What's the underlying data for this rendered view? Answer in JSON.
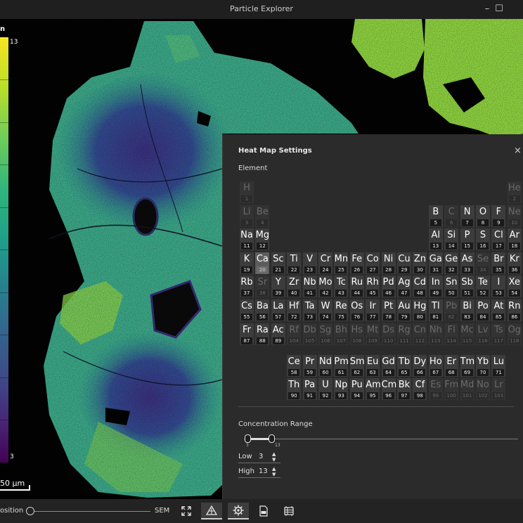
{
  "window": {
    "title": "Particle Explorer",
    "minimize": "–",
    "maximize": "☐"
  },
  "scale": {
    "top_label": "n",
    "max": "13",
    "min": "3",
    "scalebar": "50 µm",
    "colors": [
      "#f8e621",
      "#6ccd5a",
      "#1f9e89",
      "#31688e",
      "#440154"
    ]
  },
  "panel": {
    "title": "Heat Map Settings",
    "close": "×",
    "element_label": "Element",
    "selected_element": "Ca",
    "elements": [
      {
        "s": "H",
        "n": "1",
        "r": 1,
        "c": 1,
        "d": true
      },
      {
        "s": "He",
        "n": "2",
        "r": 1,
        "c": 18,
        "d": true
      },
      {
        "s": "Li",
        "n": "3",
        "r": 2,
        "c": 1,
        "d": true
      },
      {
        "s": "Be",
        "n": "4",
        "r": 2,
        "c": 2,
        "d": true
      },
      {
        "s": "B",
        "n": "5",
        "r": 2,
        "c": 13,
        "d": false
      },
      {
        "s": "C",
        "n": "6",
        "r": 2,
        "c": 14,
        "d": true
      },
      {
        "s": "N",
        "n": "7",
        "r": 2,
        "c": 15,
        "d": false
      },
      {
        "s": "O",
        "n": "8",
        "r": 2,
        "c": 16,
        "d": false
      },
      {
        "s": "F",
        "n": "9",
        "r": 2,
        "c": 17,
        "d": false
      },
      {
        "s": "Ne",
        "n": "10",
        "r": 2,
        "c": 18,
        "d": true
      },
      {
        "s": "Na",
        "n": "11",
        "r": 3,
        "c": 1,
        "d": false
      },
      {
        "s": "Mg",
        "n": "12",
        "r": 3,
        "c": 2,
        "d": false
      },
      {
        "s": "Al",
        "n": "13",
        "r": 3,
        "c": 13,
        "d": false
      },
      {
        "s": "Si",
        "n": "14",
        "r": 3,
        "c": 14,
        "d": false
      },
      {
        "s": "P",
        "n": "15",
        "r": 3,
        "c": 15,
        "d": false
      },
      {
        "s": "S",
        "n": "16",
        "r": 3,
        "c": 16,
        "d": false
      },
      {
        "s": "Cl",
        "n": "17",
        "r": 3,
        "c": 17,
        "d": false
      },
      {
        "s": "Ar",
        "n": "18",
        "r": 3,
        "c": 18,
        "d": false
      },
      {
        "s": "K",
        "n": "19",
        "r": 4,
        "c": 1,
        "d": false
      },
      {
        "s": "Ca",
        "n": "20",
        "r": 4,
        "c": 2,
        "d": false
      },
      {
        "s": "Sc",
        "n": "21",
        "r": 4,
        "c": 3,
        "d": false
      },
      {
        "s": "Ti",
        "n": "22",
        "r": 4,
        "c": 4,
        "d": false
      },
      {
        "s": "V",
        "n": "23",
        "r": 4,
        "c": 5,
        "d": false
      },
      {
        "s": "Cr",
        "n": "24",
        "r": 4,
        "c": 6,
        "d": false
      },
      {
        "s": "Mn",
        "n": "25",
        "r": 4,
        "c": 7,
        "d": false
      },
      {
        "s": "Fe",
        "n": "26",
        "r": 4,
        "c": 8,
        "d": false
      },
      {
        "s": "Co",
        "n": "27",
        "r": 4,
        "c": 9,
        "d": false
      },
      {
        "s": "Ni",
        "n": "28",
        "r": 4,
        "c": 10,
        "d": false
      },
      {
        "s": "Cu",
        "n": "29",
        "r": 4,
        "c": 11,
        "d": false
      },
      {
        "s": "Zn",
        "n": "30",
        "r": 4,
        "c": 12,
        "d": false
      },
      {
        "s": "Ga",
        "n": "31",
        "r": 4,
        "c": 13,
        "d": false
      },
      {
        "s": "Ge",
        "n": "32",
        "r": 4,
        "c": 14,
        "d": false
      },
      {
        "s": "As",
        "n": "33",
        "r": 4,
        "c": 15,
        "d": false
      },
      {
        "s": "Se",
        "n": "34",
        "r": 4,
        "c": 16,
        "d": true
      },
      {
        "s": "Br",
        "n": "35",
        "r": 4,
        "c": 17,
        "d": false
      },
      {
        "s": "Kr",
        "n": "36",
        "r": 4,
        "c": 18,
        "d": false
      },
      {
        "s": "Rb",
        "n": "37",
        "r": 5,
        "c": 1,
        "d": false
      },
      {
        "s": "Sr",
        "n": "38",
        "r": 5,
        "c": 2,
        "d": true
      },
      {
        "s": "Y",
        "n": "39",
        "r": 5,
        "c": 3,
        "d": false
      },
      {
        "s": "Zr",
        "n": "40",
        "r": 5,
        "c": 4,
        "d": false
      },
      {
        "s": "Nb",
        "n": "41",
        "r": 5,
        "c": 5,
        "d": false
      },
      {
        "s": "Mo",
        "n": "42",
        "r": 5,
        "c": 6,
        "d": false
      },
      {
        "s": "Tc",
        "n": "43",
        "r": 5,
        "c": 7,
        "d": false
      },
      {
        "s": "Ru",
        "n": "44",
        "r": 5,
        "c": 8,
        "d": false
      },
      {
        "s": "Rh",
        "n": "45",
        "r": 5,
        "c": 9,
        "d": false
      },
      {
        "s": "Pd",
        "n": "46",
        "r": 5,
        "c": 10,
        "d": false
      },
      {
        "s": "Ag",
        "n": "47",
        "r": 5,
        "c": 11,
        "d": false
      },
      {
        "s": "Cd",
        "n": "48",
        "r": 5,
        "c": 12,
        "d": false
      },
      {
        "s": "In",
        "n": "49",
        "r": 5,
        "c": 13,
        "d": false
      },
      {
        "s": "Sn",
        "n": "50",
        "r": 5,
        "c": 14,
        "d": false
      },
      {
        "s": "Sb",
        "n": "51",
        "r": 5,
        "c": 15,
        "d": false
      },
      {
        "s": "Te",
        "n": "52",
        "r": 5,
        "c": 16,
        "d": false
      },
      {
        "s": "I",
        "n": "53",
        "r": 5,
        "c": 17,
        "d": false
      },
      {
        "s": "Xe",
        "n": "54",
        "r": 5,
        "c": 18,
        "d": false
      },
      {
        "s": "Cs",
        "n": "55",
        "r": 6,
        "c": 1,
        "d": false
      },
      {
        "s": "Ba",
        "n": "56",
        "r": 6,
        "c": 2,
        "d": false
      },
      {
        "s": "La",
        "n": "57",
        "r": 6,
        "c": 3,
        "d": false
      },
      {
        "s": "Hf",
        "n": "72",
        "r": 6,
        "c": 4,
        "d": false
      },
      {
        "s": "Ta",
        "n": "73",
        "r": 6,
        "c": 5,
        "d": false
      },
      {
        "s": "W",
        "n": "74",
        "r": 6,
        "c": 6,
        "d": false
      },
      {
        "s": "Re",
        "n": "75",
        "r": 6,
        "c": 7,
        "d": false
      },
      {
        "s": "Os",
        "n": "76",
        "r": 6,
        "c": 8,
        "d": false
      },
      {
        "s": "Ir",
        "n": "77",
        "r": 6,
        "c": 9,
        "d": false
      },
      {
        "s": "Pt",
        "n": "78",
        "r": 6,
        "c": 10,
        "d": false
      },
      {
        "s": "Au",
        "n": "79",
        "r": 6,
        "c": 11,
        "d": false
      },
      {
        "s": "Hg",
        "n": "80",
        "r": 6,
        "c": 12,
        "d": false
      },
      {
        "s": "Tl",
        "n": "81",
        "r": 6,
        "c": 13,
        "d": false
      },
      {
        "s": "Pb",
        "n": "82",
        "r": 6,
        "c": 14,
        "d": true
      },
      {
        "s": "Bi",
        "n": "83",
        "r": 6,
        "c": 15,
        "d": false
      },
      {
        "s": "Po",
        "n": "84",
        "r": 6,
        "c": 16,
        "d": false
      },
      {
        "s": "At",
        "n": "85",
        "r": 6,
        "c": 17,
        "d": false
      },
      {
        "s": "Rn",
        "n": "86",
        "r": 6,
        "c": 18,
        "d": false
      },
      {
        "s": "Fr",
        "n": "87",
        "r": 7,
        "c": 1,
        "d": false
      },
      {
        "s": "Ra",
        "n": "88",
        "r": 7,
        "c": 2,
        "d": false
      },
      {
        "s": "Ac",
        "n": "89",
        "r": 7,
        "c": 3,
        "d": false
      },
      {
        "s": "Rf",
        "n": "104",
        "r": 7,
        "c": 4,
        "d": true
      },
      {
        "s": "Db",
        "n": "105",
        "r": 7,
        "c": 5,
        "d": true
      },
      {
        "s": "Sg",
        "n": "106",
        "r": 7,
        "c": 6,
        "d": true
      },
      {
        "s": "Bh",
        "n": "107",
        "r": 7,
        "c": 7,
        "d": true
      },
      {
        "s": "Hs",
        "n": "108",
        "r": 7,
        "c": 8,
        "d": true
      },
      {
        "s": "Mt",
        "n": "109",
        "r": 7,
        "c": 9,
        "d": true
      },
      {
        "s": "Ds",
        "n": "110",
        "r": 7,
        "c": 10,
        "d": true
      },
      {
        "s": "Rg",
        "n": "111",
        "r": 7,
        "c": 11,
        "d": true
      },
      {
        "s": "Cn",
        "n": "112",
        "r": 7,
        "c": 12,
        "d": true
      },
      {
        "s": "Nh",
        "n": "113",
        "r": 7,
        "c": 13,
        "d": true
      },
      {
        "s": "Fl",
        "n": "114",
        "r": 7,
        "c": 14,
        "d": true
      },
      {
        "s": "Mc",
        "n": "115",
        "r": 7,
        "c": 15,
        "d": true
      },
      {
        "s": "Lv",
        "n": "116",
        "r": 7,
        "c": 16,
        "d": true
      },
      {
        "s": "Ts",
        "n": "117",
        "r": 7,
        "c": 17,
        "d": true
      },
      {
        "s": "Og",
        "n": "118",
        "r": 7,
        "c": 18,
        "d": true
      },
      {
        "s": "Ce",
        "n": "58",
        "r": 8,
        "c": 4,
        "d": false
      },
      {
        "s": "Pr",
        "n": "59",
        "r": 8,
        "c": 5,
        "d": false
      },
      {
        "s": "Nd",
        "n": "60",
        "r": 8,
        "c": 6,
        "d": false
      },
      {
        "s": "Pm",
        "n": "61",
        "r": 8,
        "c": 7,
        "d": false
      },
      {
        "s": "Sm",
        "n": "62",
        "r": 8,
        "c": 8,
        "d": false
      },
      {
        "s": "Eu",
        "n": "63",
        "r": 8,
        "c": 9,
        "d": false
      },
      {
        "s": "Gd",
        "n": "64",
        "r": 8,
        "c": 10,
        "d": false
      },
      {
        "s": "Tb",
        "n": "65",
        "r": 8,
        "c": 11,
        "d": false
      },
      {
        "s": "Dy",
        "n": "66",
        "r": 8,
        "c": 12,
        "d": false
      },
      {
        "s": "Ho",
        "n": "67",
        "r": 8,
        "c": 13,
        "d": false
      },
      {
        "s": "Er",
        "n": "68",
        "r": 8,
        "c": 14,
        "d": false
      },
      {
        "s": "Tm",
        "n": "69",
        "r": 8,
        "c": 15,
        "d": false
      },
      {
        "s": "Yb",
        "n": "70",
        "r": 8,
        "c": 16,
        "d": false
      },
      {
        "s": "Lu",
        "n": "71",
        "r": 8,
        "c": 17,
        "d": false
      },
      {
        "s": "Th",
        "n": "90",
        "r": 9,
        "c": 4,
        "d": false
      },
      {
        "s": "Pa",
        "n": "91",
        "r": 9,
        "c": 5,
        "d": false
      },
      {
        "s": "U",
        "n": "92",
        "r": 9,
        "c": 6,
        "d": false
      },
      {
        "s": "Np",
        "n": "93",
        "r": 9,
        "c": 7,
        "d": false
      },
      {
        "s": "Pu",
        "n": "94",
        "r": 9,
        "c": 8,
        "d": false
      },
      {
        "s": "Am",
        "n": "95",
        "r": 9,
        "c": 9,
        "d": false
      },
      {
        "s": "Cm",
        "n": "96",
        "r": 9,
        "c": 10,
        "d": false
      },
      {
        "s": "Bk",
        "n": "97",
        "r": 9,
        "c": 11,
        "d": false
      },
      {
        "s": "Cf",
        "n": "98",
        "r": 9,
        "c": 12,
        "d": false
      },
      {
        "s": "Es",
        "n": "99",
        "r": 9,
        "c": 13,
        "d": true
      },
      {
        "s": "Fm",
        "n": "100",
        "r": 9,
        "c": 14,
        "d": true
      },
      {
        "s": "Md",
        "n": "101",
        "r": 9,
        "c": 15,
        "d": true
      },
      {
        "s": "No",
        "n": "102",
        "r": 9,
        "c": 16,
        "d": true
      },
      {
        "s": "Lr",
        "n": "103",
        "r": 9,
        "c": 17,
        "d": true
      }
    ],
    "concentration": {
      "label": "Concentration Range",
      "min_tick": "3",
      "max_tick": "13",
      "low_label": "Low",
      "low_value": "3",
      "high_label": "High",
      "high_value": "13",
      "spin_up": "▲",
      "spin_down": "▼"
    }
  },
  "toolbar": {
    "position_label": "osition",
    "sem_label": "SEM"
  }
}
